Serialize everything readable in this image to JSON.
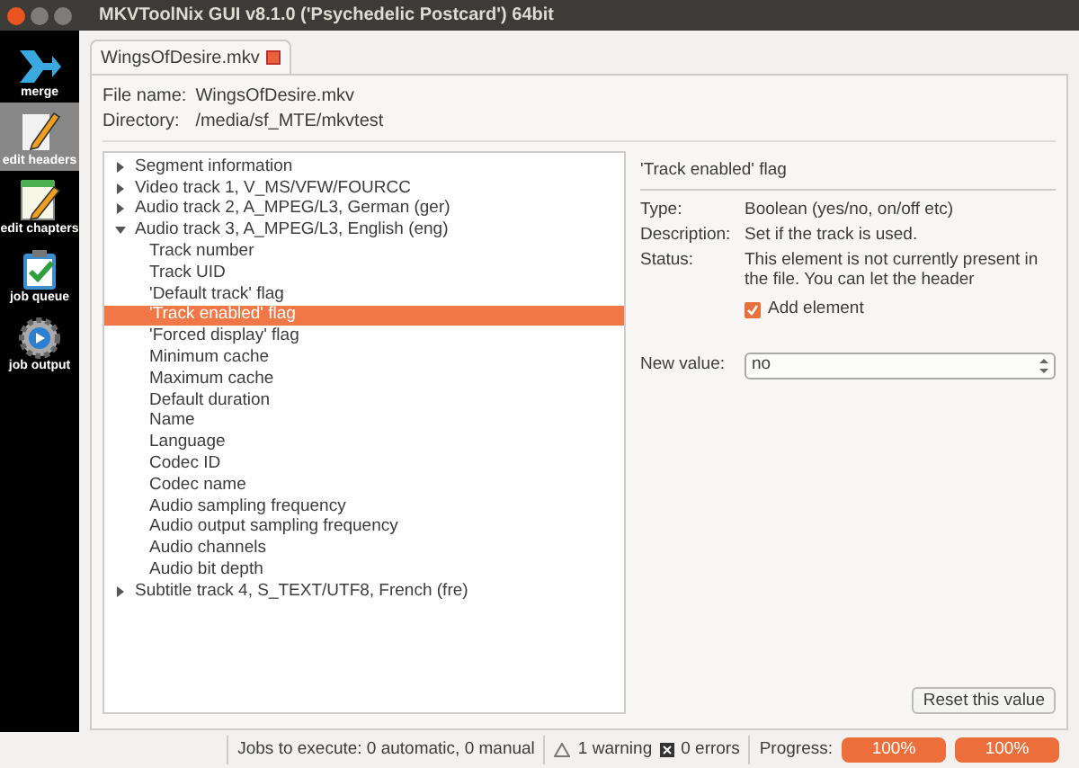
{
  "window": {
    "title": "MKVToolNix GUI v8.1.0 ('Psychedelic Postcard') 64bit"
  },
  "sidebar": {
    "items": [
      {
        "label": "merge",
        "selected": false
      },
      {
        "label": "edit headers",
        "selected": true
      },
      {
        "label": "edit chapters",
        "selected": false
      },
      {
        "label": "job queue",
        "selected": false
      },
      {
        "label": "job output",
        "selected": false
      }
    ]
  },
  "tabs": [
    {
      "label": "WingsOfDesire.mkv",
      "selected": true
    }
  ],
  "file": {
    "name_label": "File name:",
    "name": "WingsOfDesire.mkv",
    "dir_label": "Directory:",
    "dir": "/media/sf_MTE/mkvtest"
  },
  "tree": [
    {
      "label": "Segment information",
      "expanded": false,
      "selected": false
    },
    {
      "label": "Video track 1, V_MS/VFW/FOURCC",
      "expanded": false,
      "selected": false
    },
    {
      "label": "Audio track 2, A_MPEG/L3, German (ger)",
      "expanded": false,
      "selected": false
    },
    {
      "label": "Audio track 3, A_MPEG/L3, English (eng)",
      "expanded": true,
      "selected": false,
      "children": [
        {
          "label": "Track number",
          "selected": false
        },
        {
          "label": "Track UID",
          "selected": false
        },
        {
          "label": "'Default track' flag",
          "selected": false
        },
        {
          "label": "'Track enabled' flag",
          "selected": true
        },
        {
          "label": "'Forced display' flag",
          "selected": false
        },
        {
          "label": "Minimum cache",
          "selected": false
        },
        {
          "label": "Maximum cache",
          "selected": false
        },
        {
          "label": "Default duration",
          "selected": false
        },
        {
          "label": "Name",
          "selected": false
        },
        {
          "label": "Language",
          "selected": false
        },
        {
          "label": "Codec ID",
          "selected": false
        },
        {
          "label": "Codec name",
          "selected": false
        },
        {
          "label": "Audio sampling frequency",
          "selected": false
        },
        {
          "label": "Audio output sampling frequency",
          "selected": false
        },
        {
          "label": "Audio channels",
          "selected": false
        },
        {
          "label": "Audio bit depth",
          "selected": false
        }
      ]
    },
    {
      "label": "Subtitle track 4, S_TEXT/UTF8, French (fre)",
      "expanded": false,
      "selected": false
    }
  ],
  "details": {
    "heading": "'Track enabled' flag",
    "rows": [
      {
        "label": "Type:",
        "value": "Boolean (yes/no, on/off etc)"
      },
      {
        "label": "Description:",
        "value": "Set if the track is used."
      },
      {
        "label": "Status:",
        "value": "This element is not currently present in the file. You can let the header"
      }
    ],
    "add_element": {
      "label": "Add element",
      "checked": true
    },
    "new_value_label": "New value:",
    "new_value": "no",
    "reset_button": "Reset this value"
  },
  "status_bar": {
    "jobs": "Jobs to execute:  0 automatic, 0 manual",
    "warnings": "1 warning",
    "errors": "0 errors",
    "progress_label": "Progress:",
    "progress": [
      {
        "text": "100%",
        "level": 1
      },
      {
        "text": "100%",
        "level": 1
      }
    ]
  }
}
